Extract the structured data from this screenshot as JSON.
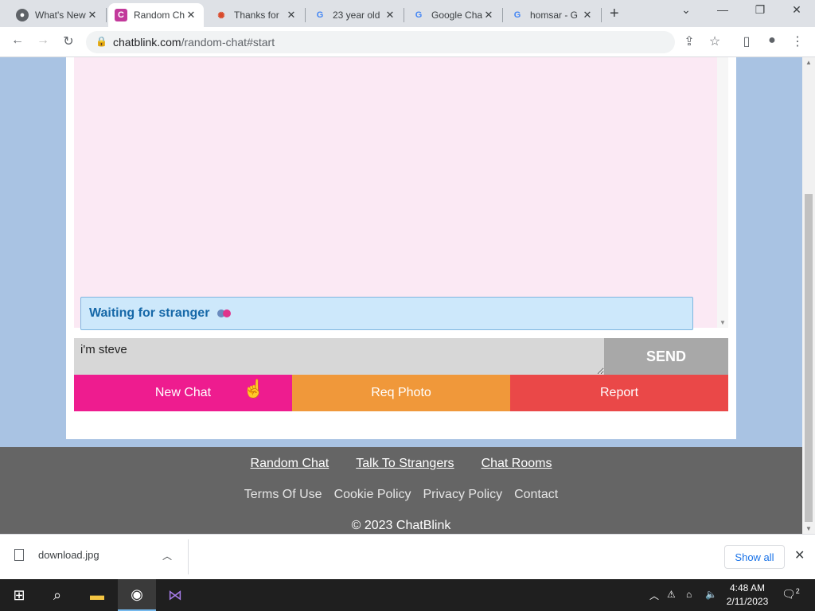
{
  "browser": {
    "tabs": [
      {
        "title": "What's New",
        "favicon": "chrome-icon"
      },
      {
        "title": "Random Chat",
        "favicon": "chatblink-icon"
      },
      {
        "title": "Thanks for",
        "favicon": "thanks-site-icon"
      },
      {
        "title": "23 year old",
        "favicon": "google-icon"
      },
      {
        "title": "Google Chat",
        "favicon": "google-icon"
      },
      {
        "title": "homsar - G",
        "favicon": "google-icon"
      }
    ],
    "active_tab_index": 1,
    "url_host": "chatblink.com",
    "url_path": "/random-chat#start"
  },
  "chat": {
    "status_text": "Waiting for stranger",
    "message_value": "i'm steve",
    "send_label": "SEND",
    "buttons": {
      "new_chat": "New Chat",
      "req_photo": "Req Photo",
      "report": "Report"
    },
    "colors": {
      "new_chat": "#ee1c8f",
      "req_photo": "#f0983a",
      "report": "#ea4848",
      "chat_bg": "#fbe9f4",
      "page_bg": "#a9c3e3"
    }
  },
  "footer": {
    "links": [
      "Random Chat",
      "Talk To Strangers",
      "Chat Rooms"
    ],
    "secondary": [
      "Terms Of Use",
      "Cookie Policy",
      "Privacy Policy",
      "Contact"
    ],
    "copyright": "© 2023 ChatBlink"
  },
  "downloads": {
    "file": "download.jpg",
    "show_all": "Show all"
  },
  "taskbar": {
    "time": "4:48 AM",
    "date": "2/11/2023",
    "notifications": "2"
  }
}
